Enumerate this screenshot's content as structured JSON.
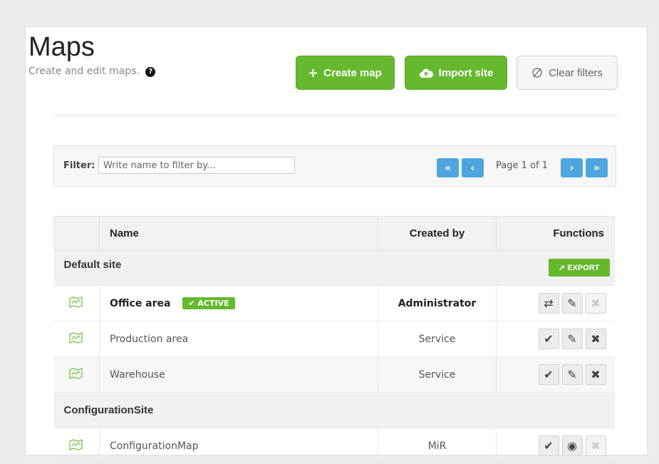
{
  "page": {
    "title": "Maps",
    "subtitle": "Create and edit maps.",
    "help_icon": "question-circle-icon"
  },
  "toolbar": {
    "create_label": "Create map",
    "import_label": "Import site",
    "clear_label": "Clear filters"
  },
  "filter": {
    "label": "Filter:",
    "placeholder": "Write name to filter by...",
    "page_text": "Page 1 of 1",
    "first": "«",
    "prev": "‹",
    "next": "›",
    "last": "»"
  },
  "table": {
    "headers": [
      "Name",
      "Created by",
      "Functions"
    ],
    "groups": [
      {
        "name": "Default site",
        "export_label": "EXPORT",
        "rows": [
          {
            "name": "Office area",
            "badge": "ACTIVE",
            "creator": "Administrator"
          },
          {
            "name": "Production area",
            "creator": "Service"
          },
          {
            "name": "Warehouse",
            "creator": "Service"
          }
        ]
      },
      {
        "name": "ConfigurationSite",
        "rows": [
          {
            "name": "ConfigurationMap",
            "creator": "MiR"
          }
        ]
      }
    ]
  },
  "colors": {
    "accent_green": "#66b82f",
    "pager_blue": "#4fa6df"
  }
}
